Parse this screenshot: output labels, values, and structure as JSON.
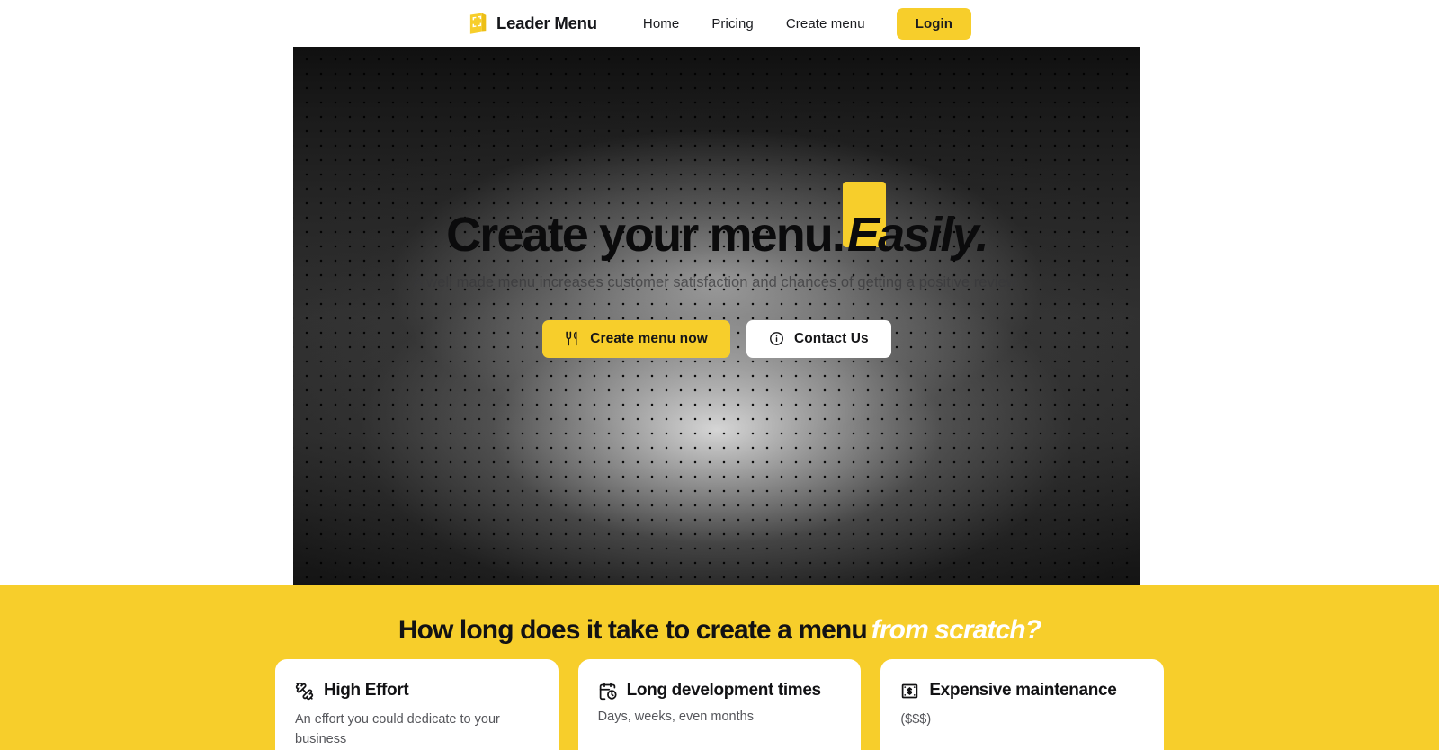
{
  "navbar": {
    "brand": "Leader Menu",
    "logo_icon": "menu-book-icon",
    "divider": "|",
    "links": [
      {
        "label": "Home",
        "name": "home"
      },
      {
        "label": "Pricing",
        "name": "pricing"
      },
      {
        "label": "Create menu",
        "name": "create-menu"
      }
    ],
    "login_label": "Login"
  },
  "hero": {
    "title_main": "Create your menu.",
    "title_accent": "Easily.",
    "subtitle": "A well made menu increases customer satisfaction and chances of getting a positive review.",
    "primary_button": {
      "label": "Create menu now",
      "icon": "utensils-icon"
    },
    "secondary_button": {
      "label": "Contact Us",
      "icon": "info-circle-icon"
    }
  },
  "problem_section": {
    "heading_main": "How long does it take to create a menu",
    "heading_accent": "from scratch?",
    "cards": [
      {
        "icon": "dumbbell-icon",
        "title": "High Effort",
        "desc": "An effort you could dedicate to your business"
      },
      {
        "icon": "calendar-clock-icon",
        "title": "Long development times",
        "desc": "Days, weeks, even months"
      },
      {
        "icon": "banknote-dollar-icon",
        "title": "Expensive maintenance",
        "desc": "($$$)"
      }
    ]
  },
  "colors": {
    "brand_yellow": "#F7CE2B",
    "text_dark": "#121214",
    "text_muted": "#55565b",
    "white": "#ffffff"
  }
}
